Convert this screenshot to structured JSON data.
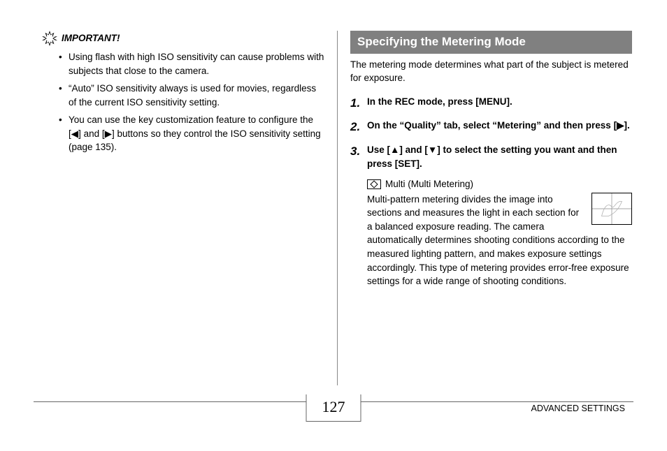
{
  "left": {
    "important_label": "IMPORTANT!",
    "bullets": [
      "Using flash with high ISO sensitivity can cause problems with subjects that close to the camera.",
      "“Auto” ISO sensitivity always is used for movies, regardless of the current ISO sensitivity setting.",
      "You can use the key customization feature to configure the [◀] and [▶] buttons so they control the ISO sensitivity setting (page 135)."
    ]
  },
  "right": {
    "heading": "Specifying the Metering Mode",
    "intro": "The metering mode determines what part of the subject is metered for exposure.",
    "steps": [
      {
        "num": "1.",
        "text": "In the REC mode, press [MENU]."
      },
      {
        "num": "2.",
        "text": "On the “Quality” tab, select “Metering” and then press [▶]."
      },
      {
        "num": "3.",
        "text": "Use [▲] and [▼] to select the setting you want and then press [SET]."
      }
    ],
    "mode_name": "Multi (Multi Metering)",
    "mode_desc": "Multi-pattern metering divides the image into sections and measures the light in each section for a balanced exposure reading. The camera automatically determines shooting conditions according to the measured lighting pattern, and makes exposure settings accordingly. This type of metering provides error-free exposure settings for a wide range of shooting conditions."
  },
  "footer": {
    "page": "127",
    "section": "ADVANCED SETTINGS"
  }
}
